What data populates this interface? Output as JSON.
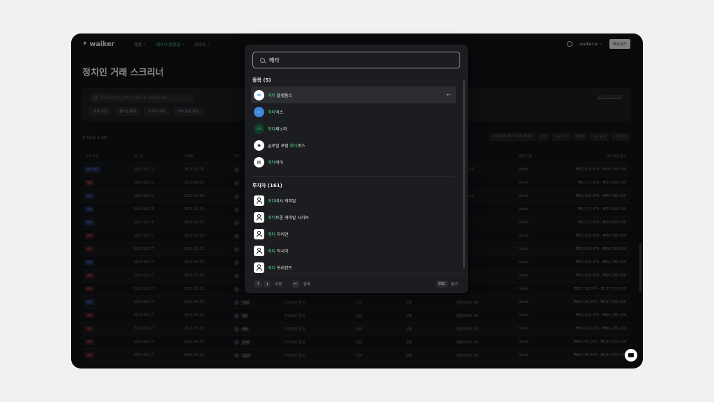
{
  "nav": {
    "logo": "waiker",
    "menu": [
      {
        "label": "제품",
        "active": false
      },
      {
        "label": "데이터 탐험실",
        "active": true
      },
      {
        "label": "리소스",
        "active": false
      }
    ],
    "account": "waiker.ai",
    "dashboard_label": "대시보드"
  },
  "page": {
    "title": "정치인 거래 스크리너",
    "search_placeholder": "종목 코드 또는 정치인 이름으로 검색해보세요",
    "reset_label": "모든 필터 초기화",
    "filter_chips": [
      "거래 유형",
      "정치인 종류",
      "소유자 유형",
      "거래 대금 범위"
    ],
    "count_label": "검색결과: 1,328",
    "period_options": [
      "2024.08.26 - 2025.08.26",
      "1일",
      "최근 7일",
      "1개월",
      "최근 30일",
      "기간선택"
    ]
  },
  "table": {
    "headers": [
      "거래 유형",
      "공시일",
      "거래일",
      "티커",
      "",
      "",
      "",
      "",
      "증권 유형",
      "거래 대금 범위"
    ],
    "rows": [
      {
        "type": "매수 매도",
        "kind": "buy",
        "disclosed": "2025.03.11",
        "traded": "2025.03.05",
        "ticker": "",
        "name": "",
        "chamber": "",
        "party": "",
        "committee": "D.C. DC00",
        "asset": "Stock",
        "amount": "₩20,636,876 - ₩68,785,000"
      },
      {
        "type": "매도",
        "kind": "sell",
        "disclosed": "2025.03.12",
        "traded": "2025.03.03",
        "ticker": "",
        "name": "",
        "chamber": "",
        "party": "",
        "committee": "KY",
        "asset": "Stock",
        "amount": "₩1,377,076 - ₩20,635,500"
      },
      {
        "type": "매수",
        "kind": "buy",
        "disclosed": "2025.02.21",
        "traded": "2025.02.18",
        "ticker": "",
        "name": "",
        "chamber": "",
        "party": "",
        "committee": "버츠 MA04",
        "asset": "Stock",
        "amount": "₩20,636,876 - ₩68,785,000"
      },
      {
        "type": "매수",
        "kind": "buy",
        "disclosed": "2025.03.25",
        "traded": "2025.02.13",
        "ticker": "",
        "name": "",
        "chamber": "",
        "party": "",
        "committee": "FL18",
        "asset": "Stock",
        "amount": "₩1,377,076 - ₩20,635,500"
      },
      {
        "type": "매수",
        "kind": "buy",
        "disclosed": "2025.03.25",
        "traded": "2025.02.13",
        "ticker": "",
        "name": "",
        "chamber": "",
        "party": "",
        "committee": "FL18",
        "asset": "Stock",
        "amount": "₩1,377,076 - ₩20,635,500"
      },
      {
        "type": "매도",
        "kind": "sell",
        "disclosed": "2025.02.27",
        "traded": "2025.02.13",
        "ticker": "",
        "name": "",
        "chamber": "",
        "party": "",
        "committee": "퍼 OK",
        "asset": "Stock",
        "amount": "₩20,636,876 - ₩68,785,000"
      },
      {
        "type": "매도",
        "kind": "sell",
        "disclosed": "2025.02.27",
        "traded": "2025.02.13",
        "ticker": "",
        "name": "",
        "chamber": "",
        "party": "",
        "committee": "퍼 OK",
        "asset": "Stock",
        "amount": "₩20,636,876 - ₩68,785,000"
      },
      {
        "type": "매수",
        "kind": "buy",
        "disclosed": "2025.02.27",
        "traded": "2025.02.13",
        "ticker": "",
        "name": "",
        "chamber": "",
        "party": "",
        "committee": "퍼 OK",
        "asset": "Stock",
        "amount": "₩20,636,876 - ₩68,785,000"
      },
      {
        "type": "매도",
        "kind": "sell",
        "disclosed": "2025.02.27",
        "traded": "2025.02.13",
        "ticker": "",
        "name": "",
        "chamber": "",
        "party": "",
        "committee": "퍼 OK",
        "asset": "Stock",
        "amount": "₩20,636,876 - ₩68,785,000"
      },
      {
        "type": "매도",
        "kind": "sell",
        "disclosed": "2025.02.27",
        "traded": "2025.02.13",
        "ticker": "",
        "name": "",
        "chamber": "",
        "party": "",
        "committee": "퍼 OK",
        "asset": "Stock",
        "amount": "₩68,786,376 - ₩137,570,000"
      },
      {
        "type": "매수",
        "kind": "buy",
        "disclosed": "2025.02.27",
        "traded": "2025.02.13",
        "ticker": "AMD",
        "name": "마크웨인 멀린",
        "chamber": "상원",
        "party": "공화",
        "committee": "모클라호마 OK",
        "asset": "Stock",
        "amount": "₩68,786,376 - ₩137,570,000"
      },
      {
        "type": "매도",
        "kind": "sell",
        "disclosed": "2025.02.27",
        "traded": "2025.02.13",
        "ticker": "TJX",
        "name": "마크웨인 멀린",
        "chamber": "상원",
        "party": "공화",
        "committee": "모클라호마 OK",
        "asset": "Stock",
        "amount": "₩20,636,876 - ₩68,785,000"
      },
      {
        "type": "매도",
        "kind": "sell",
        "disclosed": "2025.02.27",
        "traded": "2025.02.13",
        "ticker": "IBM",
        "name": "마크웨인 멀린",
        "chamber": "상원",
        "party": "공화",
        "committee": "모클라호마 OK",
        "asset": "Stock",
        "amount": "₩20,636,876 - ₩68,785,000"
      },
      {
        "type": "매도",
        "kind": "sell",
        "disclosed": "2025.02.27",
        "traded": "2025.02.13",
        "ticker": "AON",
        "name": "마크웨인 멀린",
        "chamber": "상원",
        "party": "공화",
        "committee": "모클라호마 OK",
        "asset": "Stock",
        "amount": "₩68,786,376 - ₩137,570,000"
      },
      {
        "type": "매도",
        "kind": "sell",
        "disclosed": "2025.02.27",
        "traded": "2025.02.13",
        "ticker": "LRLA",
        "name": "마크웨인 멀린",
        "chamber": "상원",
        "party": "공화",
        "committee": "모클라호마 OK",
        "asset": "Stock",
        "amount": "₩68,786,376 - ₩137,570,000"
      }
    ]
  },
  "modal": {
    "query": "메타",
    "sections": [
      {
        "title": "종목 (5)",
        "items": [
          {
            "highlight": "메타",
            "rest": " 플랫폼스",
            "prefix": "",
            "icon": "meta-logo-icon",
            "glyph": "∞",
            "cls": "meta",
            "selected": true
          },
          {
            "highlight": "메타",
            "rest": "넥스",
            "prefix": "",
            "icon": "metanex-logo-icon",
            "glyph": "—",
            "cls": "metax",
            "selected": false
          },
          {
            "highlight": "메타",
            "rest": "제노미",
            "prefix": "",
            "icon": "bars-logo-icon",
            "glyph": "ılı",
            "cls": "bars",
            "selected": false
          },
          {
            "highlight": "메타",
            "rest": "버스",
            "prefix": "글로벌 포럼 ",
            "icon": "globe-logo-icon",
            "glyph": "◉",
            "cls": "glob",
            "selected": false
          },
          {
            "highlight": "메타",
            "rest": "비아",
            "prefix": "",
            "icon": "document-logo-icon",
            "glyph": "▤",
            "cls": "doc",
            "selected": false
          }
        ]
      },
      {
        "title": "투자자 (161)",
        "items": [
          {
            "highlight": "메타",
            "rest": "버시 캐피탈",
            "prefix": "",
            "icon": "person-icon"
          },
          {
            "highlight": "메타",
            "rest": "트론 캐피탈 시카브",
            "prefix": "",
            "icon": "person-icon"
          },
          {
            "highlight": "메타",
            "rest": " 자이언",
            "prefix": "",
            "icon": "person-icon"
          },
          {
            "highlight": "메타",
            "rest": " 악시아",
            "prefix": "",
            "icon": "person-icon"
          },
          {
            "highlight": "메타",
            "rest": " 쉬리칸트",
            "prefix": "",
            "icon": "person-icon"
          }
        ]
      }
    ],
    "footer": {
      "up_key": "↑",
      "down_key": "↓",
      "move_label": "이동",
      "enter_key": "↩",
      "search_label": "검색",
      "esc_key": "ESC",
      "close_label": "닫기"
    }
  },
  "colors": {
    "accent": "#44c46d",
    "bg": "#111214",
    "modal": "#1c1d20"
  }
}
